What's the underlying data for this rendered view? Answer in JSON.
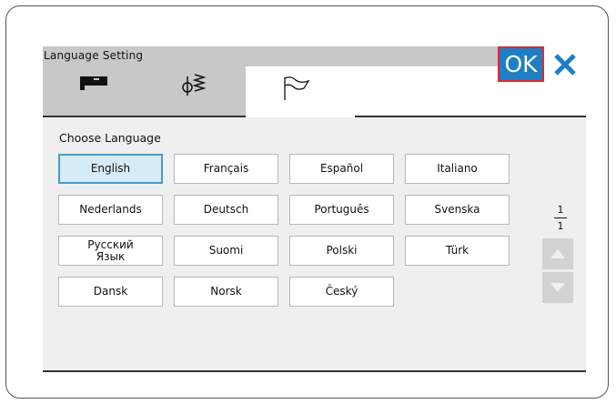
{
  "window": {
    "title": "Language Setting"
  },
  "toolbar": {
    "ok_label": "OK"
  },
  "tabs": [
    {
      "icon": "sewing-machine-icon"
    },
    {
      "icon": "stitch-needle-icon"
    },
    {
      "icon": "flag-icon",
      "active": true
    }
  ],
  "main": {
    "heading": "Choose Language",
    "languages": [
      {
        "label": "English",
        "selected": true
      },
      {
        "label": "Français"
      },
      {
        "label": "Español"
      },
      {
        "label": "Italiano"
      },
      {
        "label": "Nederlands"
      },
      {
        "label": "Deutsch"
      },
      {
        "label": "Português"
      },
      {
        "label": "Svenska"
      },
      {
        "label": "Русский Язык"
      },
      {
        "label": "Suomi"
      },
      {
        "label": "Polski"
      },
      {
        "label": "Türk"
      },
      {
        "label": "Dansk"
      },
      {
        "label": "Norsk"
      },
      {
        "label": "Český"
      }
    ]
  },
  "pager": {
    "current": "1",
    "total": "1"
  },
  "colors": {
    "accent": "#1f7fc4",
    "highlight": "#e0282e",
    "selected_bg": "#d5ebf5"
  }
}
